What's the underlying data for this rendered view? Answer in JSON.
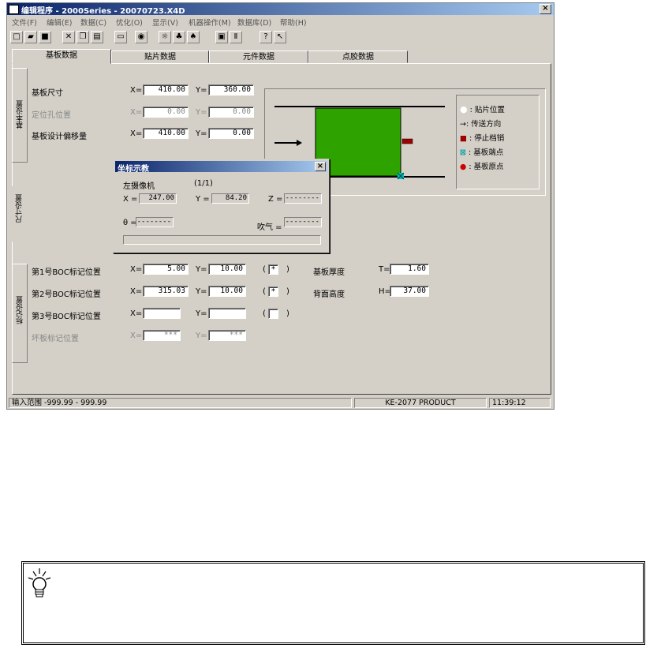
{
  "window": {
    "title": "编辑程序 - 2000Series - 20070723.X4D",
    "close": "×"
  },
  "menu": [
    "文件(F)",
    "编辑(E)",
    "数据(C)",
    "优化(O)",
    "显示(V)",
    "机器操作(M)",
    "数据库(D)",
    "帮助(H)"
  ],
  "tabs": [
    "基板数据",
    "贴片数据",
    "元件数据",
    "点胶数据"
  ],
  "side_tabs": [
    "基本设置",
    "尺寸设置",
    "标记设置"
  ],
  "board": {
    "size": {
      "label": "基板尺寸",
      "x": "410.00",
      "y": "360.00"
    },
    "locating_hole": {
      "label": "定位孔位置",
      "x": "0.00",
      "y": "0.00"
    },
    "design_offset": {
      "label": "基板设计偏移量",
      "x": "410.00",
      "y": "0.00"
    },
    "x_prefix": "X=",
    "y_prefix": "Y="
  },
  "legend": {
    "place_pos": ": 贴片位置",
    "direction": ": 传送方向",
    "stop_pin": ": 停止档销",
    "board_end": ": 基板端点",
    "board_origin": ": 基板原点"
  },
  "colors": {
    "board_fill": "#2ea300",
    "stop_pin": "#a00000",
    "end_marker": "#00c0c0",
    "origin_dot": "#cc0000",
    "title_start": "#0a246a",
    "title_end": "#a6caf0"
  },
  "dialog": {
    "title": "坐标示教",
    "camera": "左摄像机",
    "page": "(1/1)",
    "x_label": "X =",
    "x_value": "247.00",
    "y_label": "Y =",
    "y_value": "84.20",
    "z_label": "Z =",
    "z_value": "--------",
    "theta_label": "θ =",
    "theta_value": "--------",
    "blow_label": "吹气 =",
    "blow_value": "--------",
    "close": "×"
  },
  "marks": {
    "rows": [
      {
        "label": "第1号BOC标记位置",
        "x": "5.00",
        "y": "10.00",
        "check": "*"
      },
      {
        "label": "第2号BOC标记位置",
        "x": "315.03",
        "y": "10.00",
        "check": "*"
      },
      {
        "label": "第3号BOC标记位置",
        "x": "",
        "y": "",
        "check": ""
      },
      {
        "label": "坏板标记位置",
        "x": "***",
        "y": "***",
        "check": ""
      }
    ],
    "paren_open": "(",
    "paren_close": ")",
    "thickness": {
      "label": "基板厚度",
      "prefix": "T=",
      "value": "1.60"
    },
    "back_height": {
      "label": "背面高度",
      "prefix": "H=",
      "value": "37.00"
    }
  },
  "status": {
    "range": "输入范围  -999.99 - 999.99",
    "product": "KE-2077 PRODUCT",
    "time": "11:39:12"
  }
}
